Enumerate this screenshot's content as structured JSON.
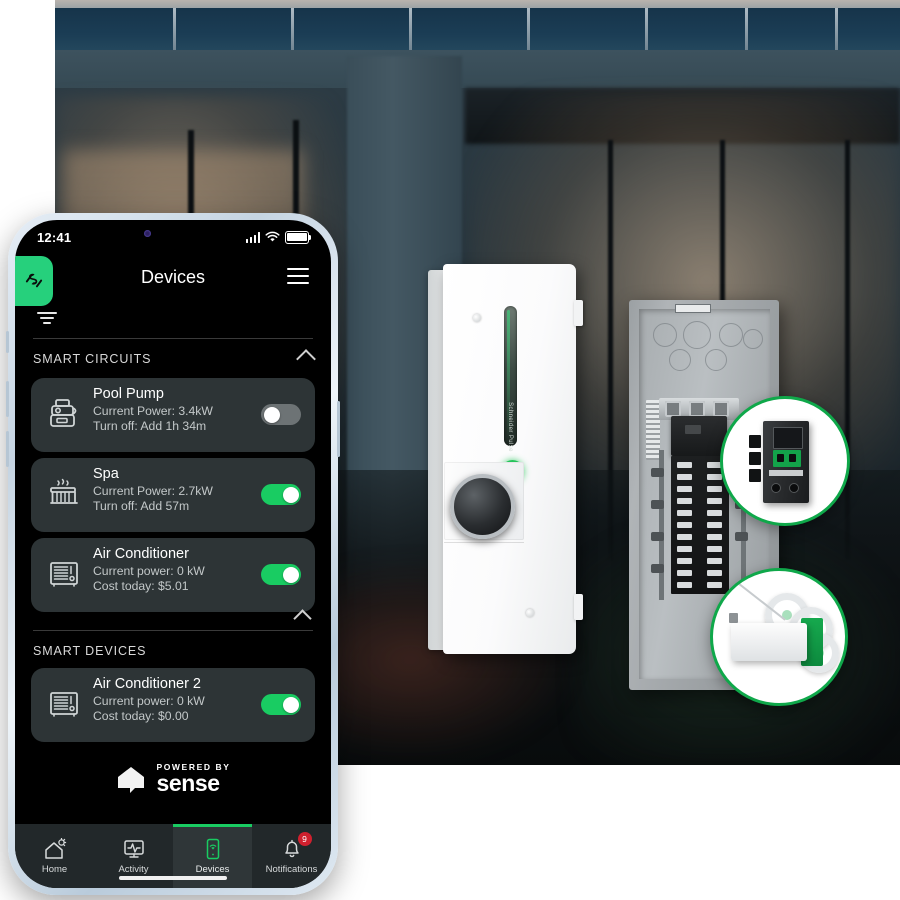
{
  "scene": {
    "background_description": "Modern home exterior at dusk with rooftop solar panels",
    "product_left": {
      "name": "Schneider Pulse",
      "brand_text": "Schneider Pulse"
    },
    "product_right": {
      "name": "Electrical load center panel"
    },
    "callouts": [
      {
        "id": "meter",
        "name": "energy-meter-module"
      },
      {
        "id": "relay",
        "name": "wireless-relay-module"
      }
    ],
    "accent_green": "#0fa84a"
  },
  "phone": {
    "status": {
      "time": "12:41",
      "cellular": "signal-bars-icon",
      "wifi": "wifi-icon",
      "battery": "battery-full-icon"
    },
    "header": {
      "brand_icon": "schneider-logo-icon",
      "title": "Devices",
      "menu_icon": "hamburger-menu-icon"
    },
    "toolbar": {
      "filter_icon": "filter-icon"
    },
    "sections": [
      {
        "label": "SMART CIRCUITS",
        "collapse_icon": "chevron-up-icon",
        "items": [
          {
            "icon": "pool-pump-icon",
            "title": "Pool Pump",
            "line1": "Current Power: 3.4kW",
            "line2": "Turn off: Add 1h 34m",
            "toggle": "off"
          },
          {
            "icon": "spa-icon",
            "title": "Spa",
            "line1": "Current Power: 2.7kW",
            "line2": "Turn off: Add 57m",
            "toggle": "on"
          },
          {
            "icon": "air-conditioner-icon",
            "title": "Air Conditioner",
            "line1": "Current power: 0 kW",
            "line2": "Cost today: $5.01",
            "toggle": "on"
          }
        ]
      },
      {
        "label": "SMART DEVICES",
        "collapse_icon": "chevron-up-icon",
        "items": [
          {
            "icon": "air-conditioner-icon",
            "title": "Air Conditioner 2",
            "line1": "Current power: 0 kW",
            "line2": "Cost today: $0.00",
            "toggle": "on"
          }
        ]
      }
    ],
    "footer_brand": {
      "icon": "sense-house-icon",
      "small_text": "POWERED BY",
      "big_text": "sense"
    },
    "tabs": [
      {
        "label": "Home",
        "icon": "home-sun-icon",
        "active": false,
        "badge": ""
      },
      {
        "label": "Activity",
        "icon": "monitor-pulse-icon",
        "active": false,
        "badge": ""
      },
      {
        "label": "Devices",
        "icon": "device-wifi-icon",
        "active": true,
        "badge": ""
      },
      {
        "label": "Notifications",
        "icon": "bell-icon",
        "active": false,
        "badge": "9"
      }
    ],
    "colors": {
      "accent": "#19cc62",
      "badge": "#d0202e",
      "card": "#2d3436"
    }
  }
}
